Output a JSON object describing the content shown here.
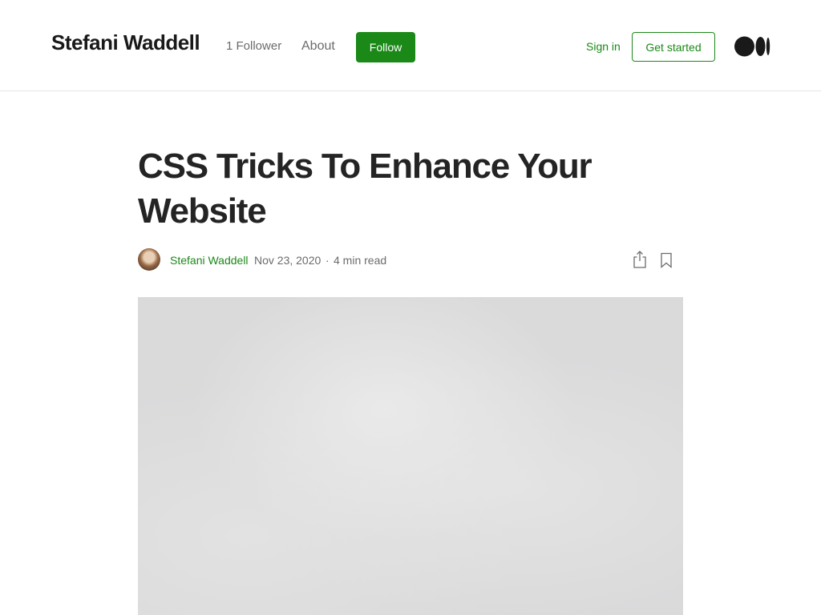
{
  "header": {
    "publication_name": "Stefani Waddell",
    "followers": "1 Follower",
    "about": "About",
    "follow_label": "Follow",
    "signin_label": "Sign in",
    "get_started_label": "Get started"
  },
  "article": {
    "title": "CSS Tricks To Enhance Your Website",
    "author": "Stefani Waddell",
    "date": "Nov 23, 2020",
    "separator": "·",
    "read_time": "4 min read"
  },
  "icons": {
    "logo": "medium-logo-icon",
    "share": "share-icon",
    "bookmark": "bookmark-icon"
  },
  "colors": {
    "accent": "#1a8917",
    "text": "#242424",
    "muted": "#6b6b6b"
  }
}
